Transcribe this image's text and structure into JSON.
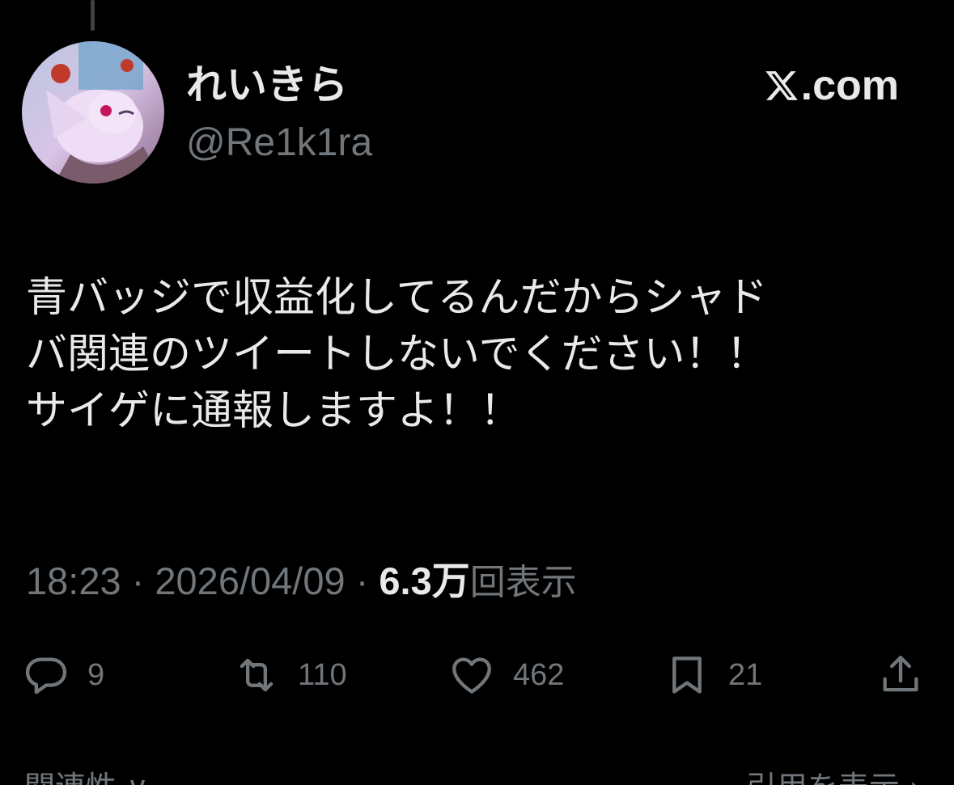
{
  "author": {
    "display_name": "れいきら",
    "handle": "@Re1k1ra"
  },
  "brand": {
    "text": ".com",
    "icon": "x-logo-icon"
  },
  "tweet": {
    "text": "青バッジで収益化してるんだからシャド\nバ関連のツイートしないでください！！\nサイゲに通報しますよ！！"
  },
  "meta": {
    "time": "18:23",
    "separator": " · ",
    "date": "2026/04/09",
    "views_count": "6.3万",
    "views_label": "回表示"
  },
  "actions": {
    "replies": {
      "icon": "reply-icon",
      "count": "9"
    },
    "retweets": {
      "icon": "retweet-icon",
      "count": "110"
    },
    "likes": {
      "icon": "heart-icon",
      "count": "462"
    },
    "bookmarks": {
      "icon": "bookmark-icon",
      "count": "21"
    },
    "share": {
      "icon": "share-icon"
    }
  },
  "footer": {
    "left": "関連性 ∨",
    "right": "引用を表示 ›"
  },
  "colors": {
    "background": "#000000",
    "primary_text": "#e7e9ea",
    "secondary_text": "#71767b"
  }
}
